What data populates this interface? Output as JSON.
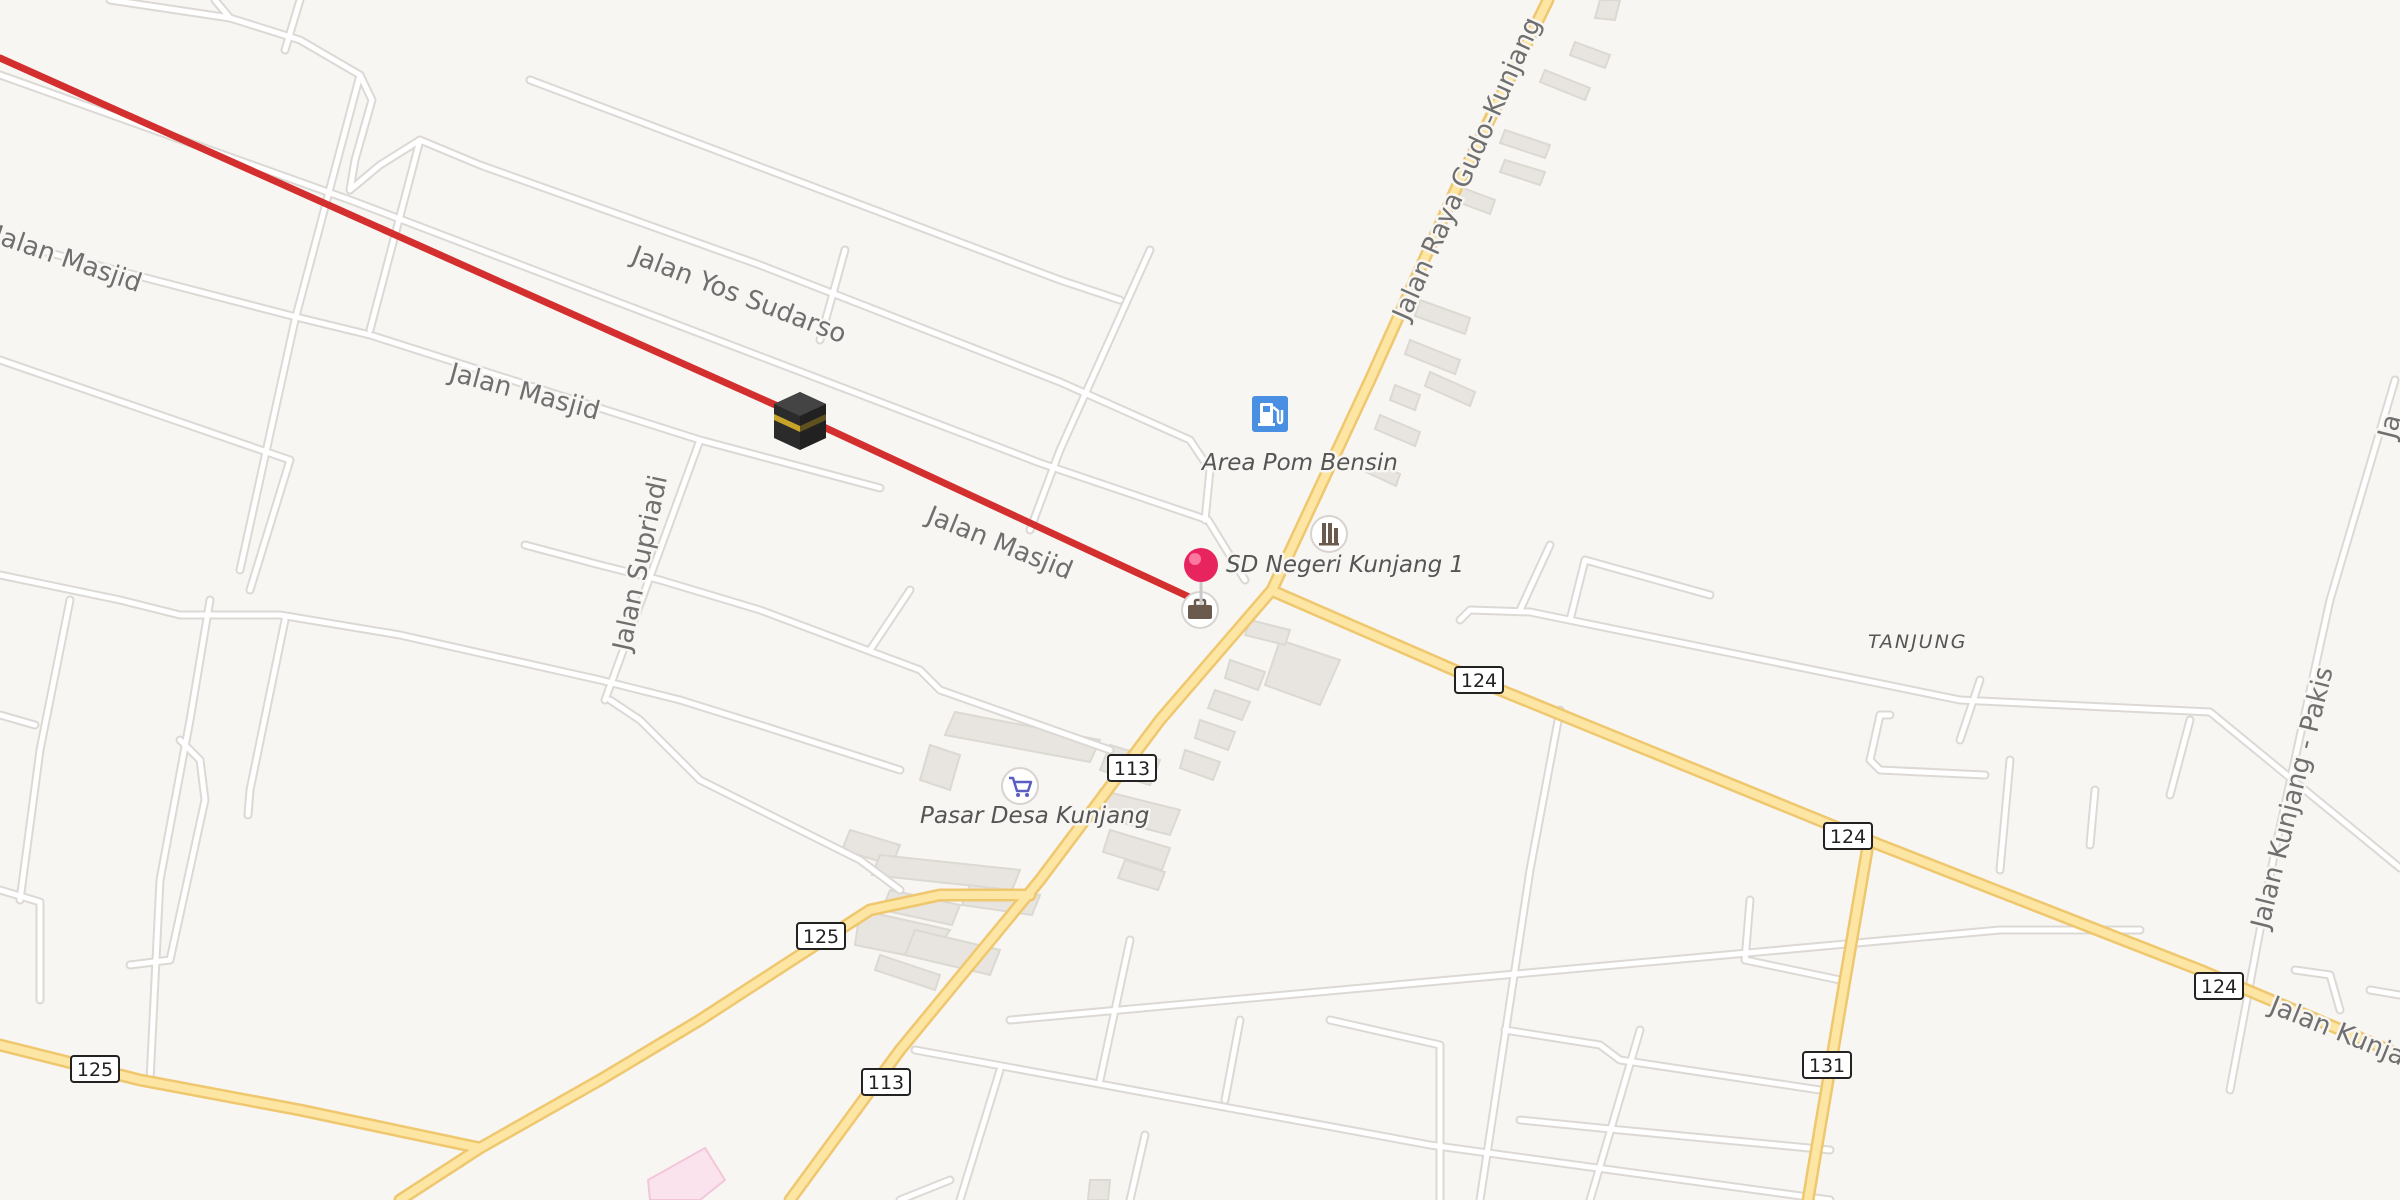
{
  "map": {
    "colors": {
      "background": "#f8f6f3",
      "minor_road": "#ffffff",
      "minor_road_casing": "#dcd9d5",
      "major_road": "#fde6a3",
      "major_road_casing": "#efc76e",
      "building": "#e8e4df",
      "route": "#d32f2f",
      "pin": "#e8245f",
      "fuel_icon": "#4a90e2"
    },
    "road_labels": {
      "jalan_masjid_west": "Jalan Masjid",
      "jalan_masjid_center": "Jalan Masjid",
      "jalan_masjid_east": "Jalan Masjid",
      "jalan_yos_sudarso": "Jalan Yos Sudarso",
      "jalan_supriadi": "Jalan Supriadi",
      "jalan_raya_gudo_kunjang": "Jalan Raya Gudo-Kunjang",
      "jalan_kunjang_pakis": "Jalan Kunjang - Pakis",
      "jalan_kunjang_east": "Jalan Kunjan"
    },
    "pois": {
      "fuel_station": {
        "label": "Area Pom Bensin",
        "icon": "fuel-pump-icon"
      },
      "school": {
        "label": "SD Negeri Kunjang 1",
        "icon": "school-icon"
      },
      "market": {
        "label": "Pasar Desa Kunjang",
        "icon": "shopping-cart-icon"
      },
      "kaaba": {
        "icon": "kaaba-icon"
      },
      "marker": {
        "icon": "map-pin-icon"
      },
      "suitcase": {
        "icon": "briefcase-icon"
      }
    },
    "place_labels": {
      "tanjung": "TANJUNG"
    },
    "route_shields": {
      "r124_a": "124",
      "r124_b": "124",
      "r124_c": "124",
      "r113_a": "113",
      "r113_b": "113",
      "r125_a": "125",
      "r125_b": "125",
      "r131": "131"
    }
  }
}
